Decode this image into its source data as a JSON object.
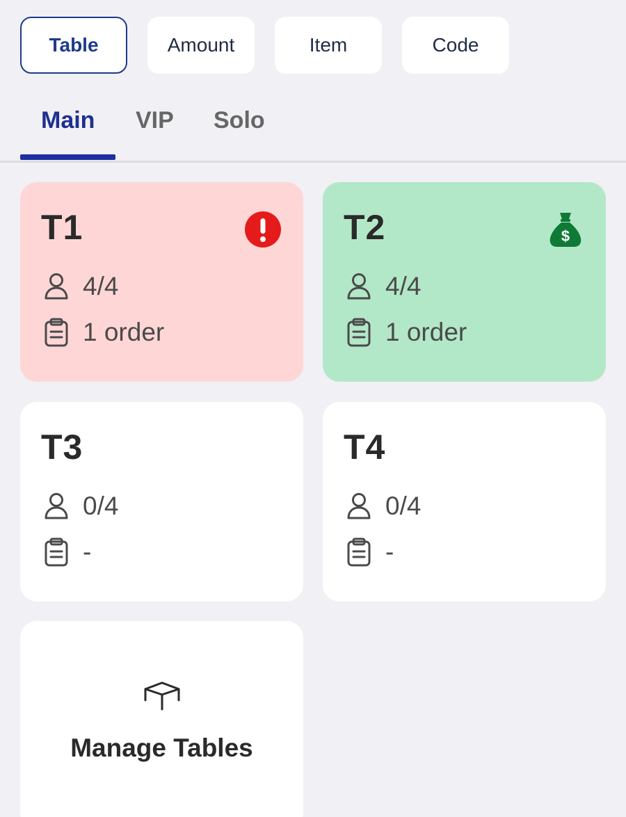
{
  "filters": [
    {
      "label": "Table",
      "active": true
    },
    {
      "label": "Amount",
      "active": false
    },
    {
      "label": "Item",
      "active": false
    },
    {
      "label": "Code",
      "active": false
    }
  ],
  "tabs": [
    {
      "label": "Main",
      "active": true
    },
    {
      "label": "VIP",
      "active": false
    },
    {
      "label": "Solo",
      "active": false
    }
  ],
  "tables": [
    {
      "name": "T1",
      "seats": "4/4",
      "orders": "1 order",
      "status": "alert",
      "badge_icon": "exclamation-circle-icon",
      "color": "#ffd6d6",
      "badge_color": "#e51b1b"
    },
    {
      "name": "T2",
      "seats": "4/4",
      "orders": "1 order",
      "status": "paid",
      "badge_icon": "money-bag-icon",
      "color": "#b2e8c8",
      "badge_color": "#0e7a36"
    },
    {
      "name": "T3",
      "seats": "0/4",
      "orders": "-",
      "status": "empty"
    },
    {
      "name": "T4",
      "seats": "0/4",
      "orders": "-",
      "status": "empty"
    }
  ],
  "manage": {
    "label": "Manage Tables",
    "icon": "table-icon"
  },
  "colors": {
    "accent": "#1e2fa0",
    "background": "#f0f0f5",
    "alert_card": "#ffd6d6",
    "paid_card": "#b2e8c8"
  }
}
